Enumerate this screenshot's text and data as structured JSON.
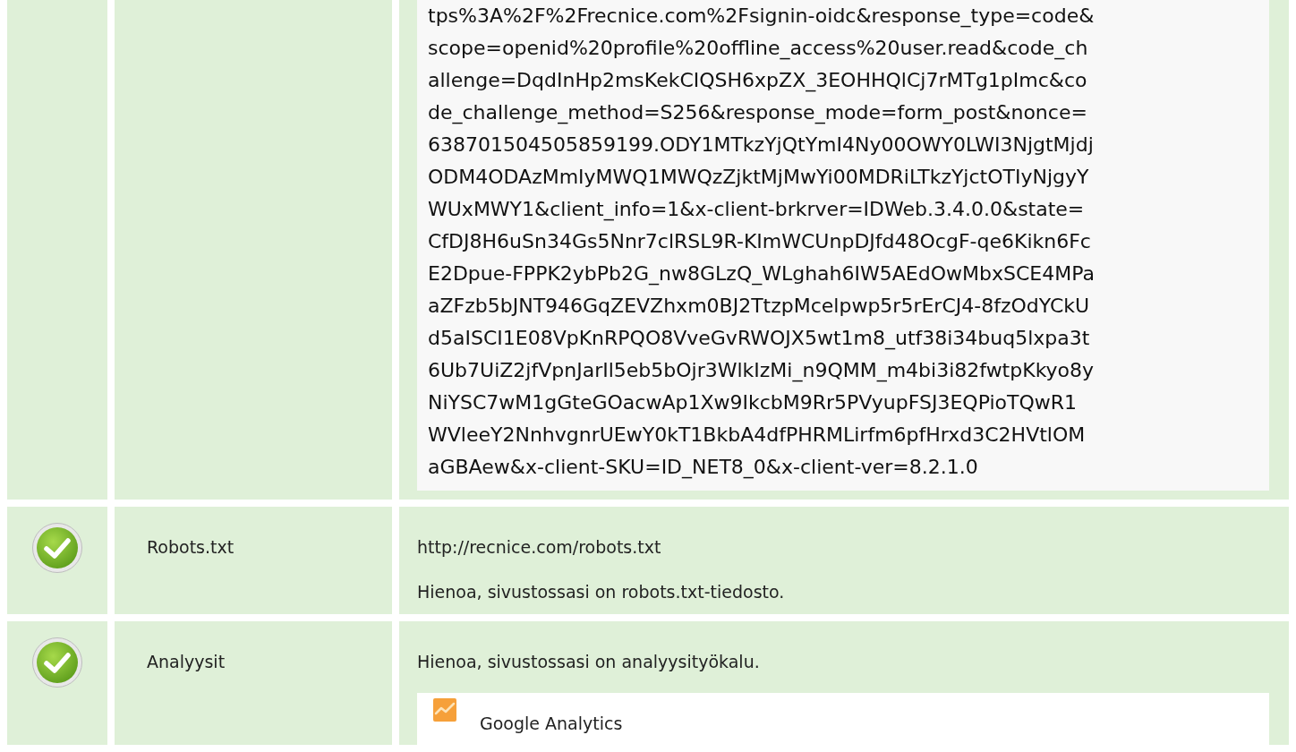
{
  "rows": [
    {
      "kind": "code",
      "lines": [
        "tps%3A%2F%2Frecnice.com%2Fsignin-oidc&response_type=code&",
        "scope=openid%20profile%20offline_access%20user.read&code_ch",
        "allenge=DqdInHp2msKekCIQSH6xpZX_3EOHHQlCj7rMTg1pImc&co",
        "de_challenge_method=S256&response_mode=form_post&nonce=",
        "638701504505859199.ODY1MTkzYjQtYmI4Ny00OWY0LWI3NjgtMjdj",
        "ODM4ODAzMmIyMWQ1MWQzZjktMjMwYi00MDRiLTkzYjctOTIyNjgyY",
        "WUxMWY1&client_info=1&x-client-brkrver=IDWeb.3.4.0.0&state=",
        "CfDJ8H6uSn34Gs5Nnr7clRSL9R-KImWCUnpDJfd48OcgF-qe6Kikn6Fc",
        "E2Dpue-FPPK2ybPb2G_nw8GLzQ_WLghah6IW5AEdOwMbxSCE4MPa",
        "aZFzb5bJNT946GqZEVZhxm0BJ2TtzpMcelpwp5r5rErCJ4-8fzOdYCkU",
        "d5aISCI1E08VpKnRPQO8VveGvRWOJX5wt1m8_utf38i34buq5lxpa3t",
        "6Ub7UiZ2jfVpnJarIl5eb5bOjr3WlkIzMi_n9QMM_m4bi3i82fwtpKkyo8y",
        "NiYSC7wM1gGteGOacwAp1Xw9IkcbM9Rr5PVyupFSJ3EQPioTQwR1",
        "WVleeY2NnhvgnrUEwY0kT1BkbA4dfPHRMLirfm6pfHrxd3C2HVtlOM",
        "aGBAew&x-client-SKU=ID_NET8_0&x-client-ver=8.2.1.0"
      ]
    },
    {
      "kind": "check",
      "passed": true,
      "label": "Robots.txt",
      "texts": [
        "http://recnice.com/robots.txt",
        "Hienoa, sivustossasi on robots.txt-tiedosto."
      ]
    },
    {
      "kind": "check",
      "passed": true,
      "label": "Analyysit",
      "texts": [
        "Hienoa, sivustossasi on analyysityökalu."
      ],
      "tools": [
        {
          "name": "Google Analytics"
        }
      ]
    }
  ]
}
